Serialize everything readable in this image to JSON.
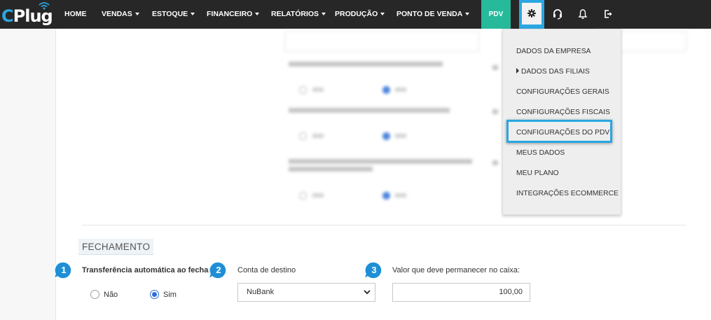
{
  "brand": {
    "logo": "CPlug"
  },
  "nav": {
    "items": [
      {
        "label": "HOME",
        "dropdown": false
      },
      {
        "label": "VENDAS",
        "dropdown": true
      },
      {
        "label": "ESTOQUE",
        "dropdown": true
      },
      {
        "label": "FINANCEIRO",
        "dropdown": true
      },
      {
        "label": "RELATÓRIOS",
        "dropdown": true
      },
      {
        "label": "PRODUÇÃO",
        "dropdown": true
      },
      {
        "label": "PONTO DE VENDA",
        "dropdown": true
      }
    ],
    "pdv_label": "PDV",
    "icons": [
      "gear-icon",
      "headset-icon",
      "bell-icon",
      "logout-icon"
    ]
  },
  "settings_menu": {
    "items": [
      {
        "label": "DADOS DA EMPRESA"
      },
      {
        "label": "DADOS DAS FILIAIS",
        "submenu": true
      },
      {
        "label": "CONFIGURAÇÕES GERAIS"
      },
      {
        "label": "CONFIGURAÇÕES FISCAIS"
      },
      {
        "label": "CONFIGURAÇÕES DO PDV",
        "highlighted": true
      },
      {
        "label": "MEUS DADOS"
      },
      {
        "label": "MEU PLANO"
      },
      {
        "label": "INTEGRAÇÕES ECOMMERCE"
      }
    ]
  },
  "fechamento": {
    "title": "FECHAMENTO",
    "transferencia": {
      "step": "1",
      "label": "Transferência automática ao fechar",
      "options": [
        "Não",
        "Sim"
      ],
      "selected": "Sim"
    },
    "conta": {
      "step": "2",
      "label": "Conta de destino",
      "value": "NuBank"
    },
    "valor": {
      "step": "3",
      "label": "Valor que deve permanecer no caixa:",
      "value": "100,00"
    }
  },
  "colors": {
    "navbar": "#272727",
    "accent": "#2aa7e2",
    "pdv": "#26b99a",
    "badge": "#1e8fd6",
    "radio": "#2d6fd6"
  }
}
